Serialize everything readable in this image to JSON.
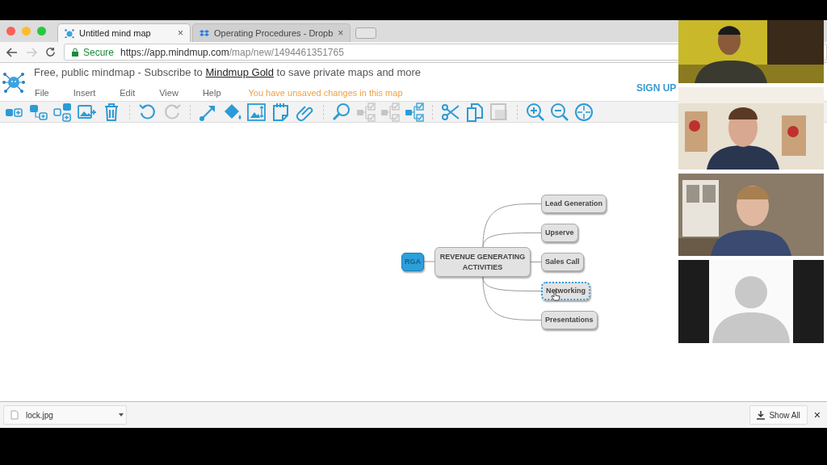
{
  "browser": {
    "tabs": [
      {
        "title": "Untitled mind map",
        "selected": true,
        "close": "×",
        "kind": "mindmup"
      },
      {
        "title": "Operating Procedures - Dropb",
        "selected": false,
        "close": "×",
        "kind": "dropbox"
      }
    ],
    "address": {
      "secure_label": "Secure",
      "url_host": "https://app.mindmup.com",
      "url_path": "/map/new/1494461351765"
    }
  },
  "app": {
    "banner": {
      "before": "Free, public mindmap - Subscribe to ",
      "link": "Mindmup Gold",
      "after": " to save private maps and more"
    },
    "menu": [
      "File",
      "Insert",
      "Edit",
      "View",
      "Help"
    ],
    "notice": "You have unsaved changes in this map",
    "sign_up": "SIGN UP",
    "toolbar": [
      {
        "kind": "add-sibling",
        "disabled": false
      },
      {
        "kind": "add-child",
        "disabled": false
      },
      {
        "kind": "add-parent",
        "disabled": false
      },
      {
        "kind": "add-image",
        "disabled": false
      },
      {
        "kind": "delete",
        "disabled": false
      },
      {
        "kind": "separator"
      },
      {
        "kind": "undo",
        "disabled": false
      },
      {
        "kind": "redo",
        "disabled": true
      },
      {
        "kind": "separator"
      },
      {
        "kind": "connect",
        "disabled": false
      },
      {
        "kind": "fill",
        "disabled": false
      },
      {
        "kind": "image-size",
        "disabled": false
      },
      {
        "kind": "note",
        "disabled": false
      },
      {
        "kind": "link",
        "disabled": false
      },
      {
        "kind": "separator"
      },
      {
        "kind": "search",
        "disabled": false
      },
      {
        "kind": "tree",
        "disabled": true
      },
      {
        "kind": "tree",
        "disabled": true
      },
      {
        "kind": "tree",
        "disabled": false
      },
      {
        "kind": "separator"
      },
      {
        "kind": "cut",
        "disabled": false
      },
      {
        "kind": "copy",
        "disabled": false
      },
      {
        "kind": "paste",
        "disabled": true
      },
      {
        "kind": "separator"
      },
      {
        "kind": "zoom-in",
        "disabled": false
      },
      {
        "kind": "zoom-out",
        "disabled": false
      },
      {
        "kind": "reset-view",
        "disabled": false
      }
    ]
  },
  "mindmap": {
    "root": {
      "label": "RGA"
    },
    "central": {
      "label": "REVENUE GENERATING ACTIVITIES"
    },
    "children": [
      {
        "label": "Lead Generation",
        "selected": false
      },
      {
        "label": "Upserve",
        "selected": false
      },
      {
        "label": "Sales Call",
        "selected": false
      },
      {
        "label": "Networking",
        "selected": true
      },
      {
        "label": "Presentations",
        "selected": false
      }
    ]
  },
  "downloads": {
    "file": "lock.jpg",
    "show_all": "Show All",
    "close": "×"
  },
  "video_call": {
    "tiles": [
      {
        "kind": "camera"
      },
      {
        "kind": "camera"
      },
      {
        "kind": "camera"
      },
      {
        "kind": "avatar"
      }
    ]
  }
}
